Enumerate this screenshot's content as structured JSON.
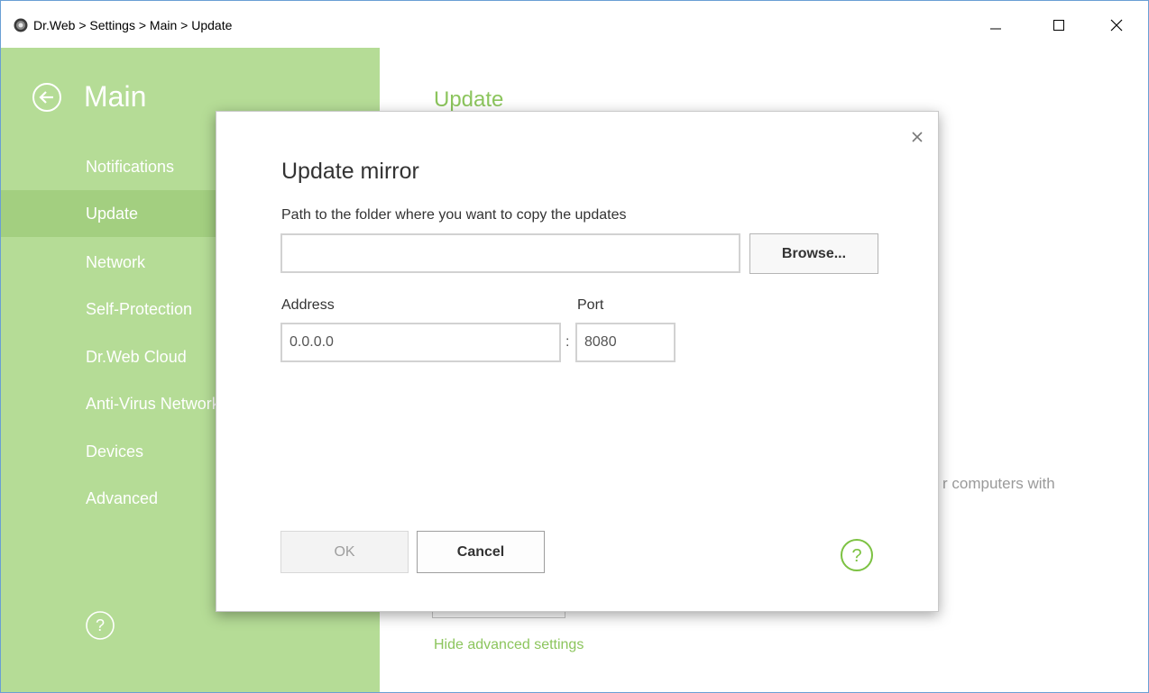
{
  "window": {
    "title": "Dr.Web > Settings > Main > Update",
    "controls": {
      "minimize": "minimize-icon",
      "maximize": "maximize-icon",
      "close": "close-icon"
    }
  },
  "sidebar": {
    "title": "Main",
    "items": [
      {
        "label": "Notifications",
        "active": false
      },
      {
        "label": "Update",
        "active": true
      },
      {
        "label": "Network",
        "active": false
      },
      {
        "label": "Self-Protection",
        "active": false
      },
      {
        "label": "Dr.Web Cloud",
        "active": false
      },
      {
        "label": "Anti-Virus Network",
        "active": false
      },
      {
        "label": "Devices",
        "active": false
      },
      {
        "label": "Advanced",
        "active": false
      }
    ]
  },
  "main": {
    "title": "Update",
    "partial_text": "r computers with",
    "hide_link": "Hide advanced settings"
  },
  "dialog": {
    "title": "Update mirror",
    "path_label": "Path to the folder where you want to copy the updates",
    "path_value": "",
    "browse_label": "Browse...",
    "address_label": "Address",
    "address_value": "0.0.0.0",
    "colon": ":",
    "port_label": "Port",
    "port_value": "8080",
    "ok_label": "OK",
    "cancel_label": "Cancel",
    "help_glyph": "?"
  },
  "colors": {
    "accent": "#8cc55d",
    "sidebar_bg": "#b5dc96",
    "sidebar_active": "#a3cf80"
  }
}
